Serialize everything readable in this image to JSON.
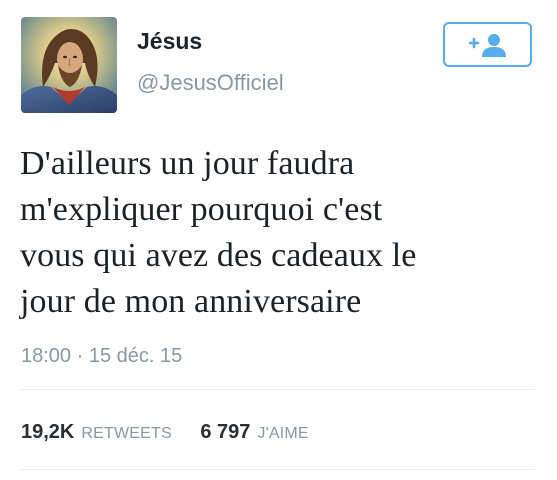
{
  "user": {
    "display_name": "Jésus",
    "handle": "@JesusOfficiel",
    "avatar_icon": "jesus-portrait-avatar"
  },
  "follow_button": {
    "icon": "add-user-icon",
    "accent": "#55acee"
  },
  "tweet": {
    "lines": [
      "D'ailleurs un jour faudra",
      "m'expliquer pourquoi c'est",
      "vous qui avez des cadeaux le",
      "jour de mon anniversaire"
    ],
    "timestamp": "18:00 · 15 déc. 15"
  },
  "stats": {
    "retweets_count": "19,2K",
    "retweets_label": "RETWEETS",
    "likes_count": "6 797",
    "likes_label": "J'AIME"
  },
  "colors": {
    "text": "#1b2126",
    "secondary": "#8899a6",
    "divider": "#e6ecf0"
  }
}
